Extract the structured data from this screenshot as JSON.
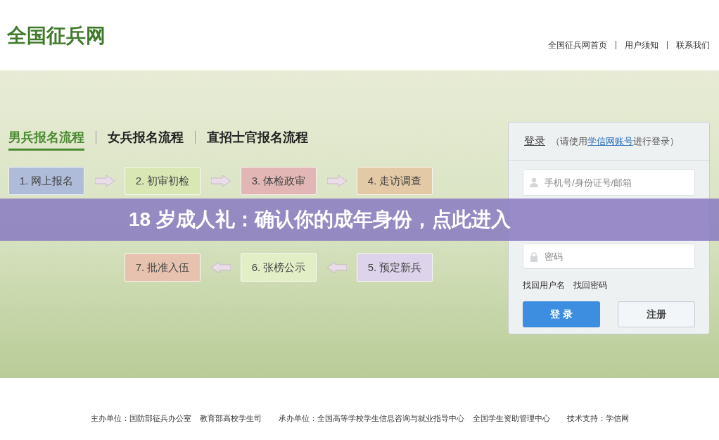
{
  "header": {
    "logo": "全国征兵网",
    "links": [
      "全国征兵网首页",
      "用户须知",
      "联系我们"
    ]
  },
  "tabs": [
    {
      "label": "男兵报名流程",
      "selected": true
    },
    {
      "label": "女兵报名流程",
      "selected": false
    },
    {
      "label": "直招士官报名流程",
      "selected": false
    }
  ],
  "steps": [
    {
      "label": "1. 网上报名",
      "color": "#aebbd9"
    },
    {
      "label": "2. 初审初检",
      "color": "#d8e7b4"
    },
    {
      "label": "3. 体检政审",
      "color": "#e2b6b4"
    },
    {
      "label": "4. 走访调查",
      "color": "#e3c9a6"
    },
    {
      "label": "7. 批准入伍",
      "color": "#e7c3af"
    },
    {
      "label": "6. 张榜公示",
      "color": "#e2efc6"
    },
    {
      "label": "5. 预定新兵",
      "color": "#ddd4ec"
    }
  ],
  "login": {
    "title": "登录",
    "hint_before": "（请使用",
    "hint_link": "学信网账号",
    "hint_after": "进行登录）",
    "username": {
      "placeholder": "手机号/身份证号/邮箱"
    },
    "password": {
      "placeholder": "密码"
    },
    "links": [
      "找回用户名",
      "找回密码"
    ],
    "login_button": "登 录",
    "register_button": "注册"
  },
  "banner": "18 岁成人礼：确认你的成年身份，点此进入",
  "footer": [
    {
      "label": "主办单位：",
      "names": [
        "国防部征兵办公室",
        "教育部高校学生司"
      ]
    },
    {
      "label": "承办单位：",
      "names": [
        "全国高等学校学生信息咨询与就业指导中心",
        "全国学生资助管理中心"
      ]
    },
    {
      "label": "技术支持：",
      "names": [
        "学信网"
      ]
    }
  ]
}
